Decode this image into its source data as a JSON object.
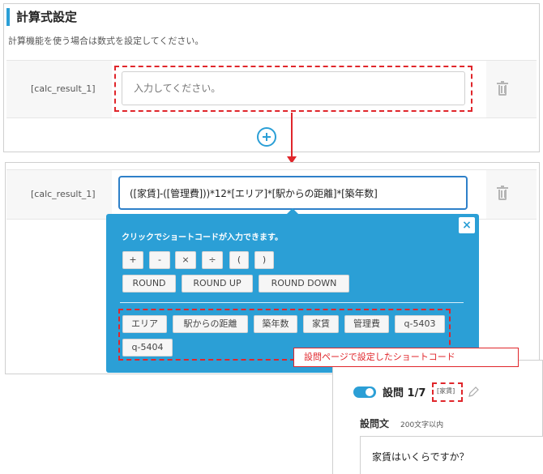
{
  "settings": {
    "title": "計算式設定",
    "subtitle": "計算機能を使う場合は数式を設定してください。"
  },
  "row1": {
    "label": "[calc_result_1]",
    "placeholder": "入力してください。"
  },
  "row2": {
    "label": "[calc_result_1]",
    "value": "([家賃]-([管理費]))*12*[エリア]*[駅からの距離]*[築年数]"
  },
  "popover": {
    "title": "クリックでショートコードが入力できます。",
    "close": "×",
    "operators": [
      "+",
      "-",
      "×",
      "÷",
      "(",
      ")"
    ],
    "functions": [
      "ROUND",
      "ROUND UP",
      "ROUND DOWN"
    ],
    "shortcodes": [
      "エリア",
      "駅からの距離",
      "築年数",
      "家賃",
      "管理費",
      "q-5403",
      "q-5404"
    ]
  },
  "callout": "設問ページで設定したショートコード",
  "question_card": {
    "label": "設問 1/7",
    "tag": "[家賃]",
    "text_label": "設問文",
    "text_hint": "200文字以内",
    "text_value": "家賃はいくらですか？"
  },
  "colors": {
    "accent": "#2b9fd6",
    "highlight": "#e0262b"
  },
  "icons": [
    "trash-icon",
    "plus-circle-icon",
    "close-icon",
    "toggle-icon",
    "pencil-icon"
  ]
}
